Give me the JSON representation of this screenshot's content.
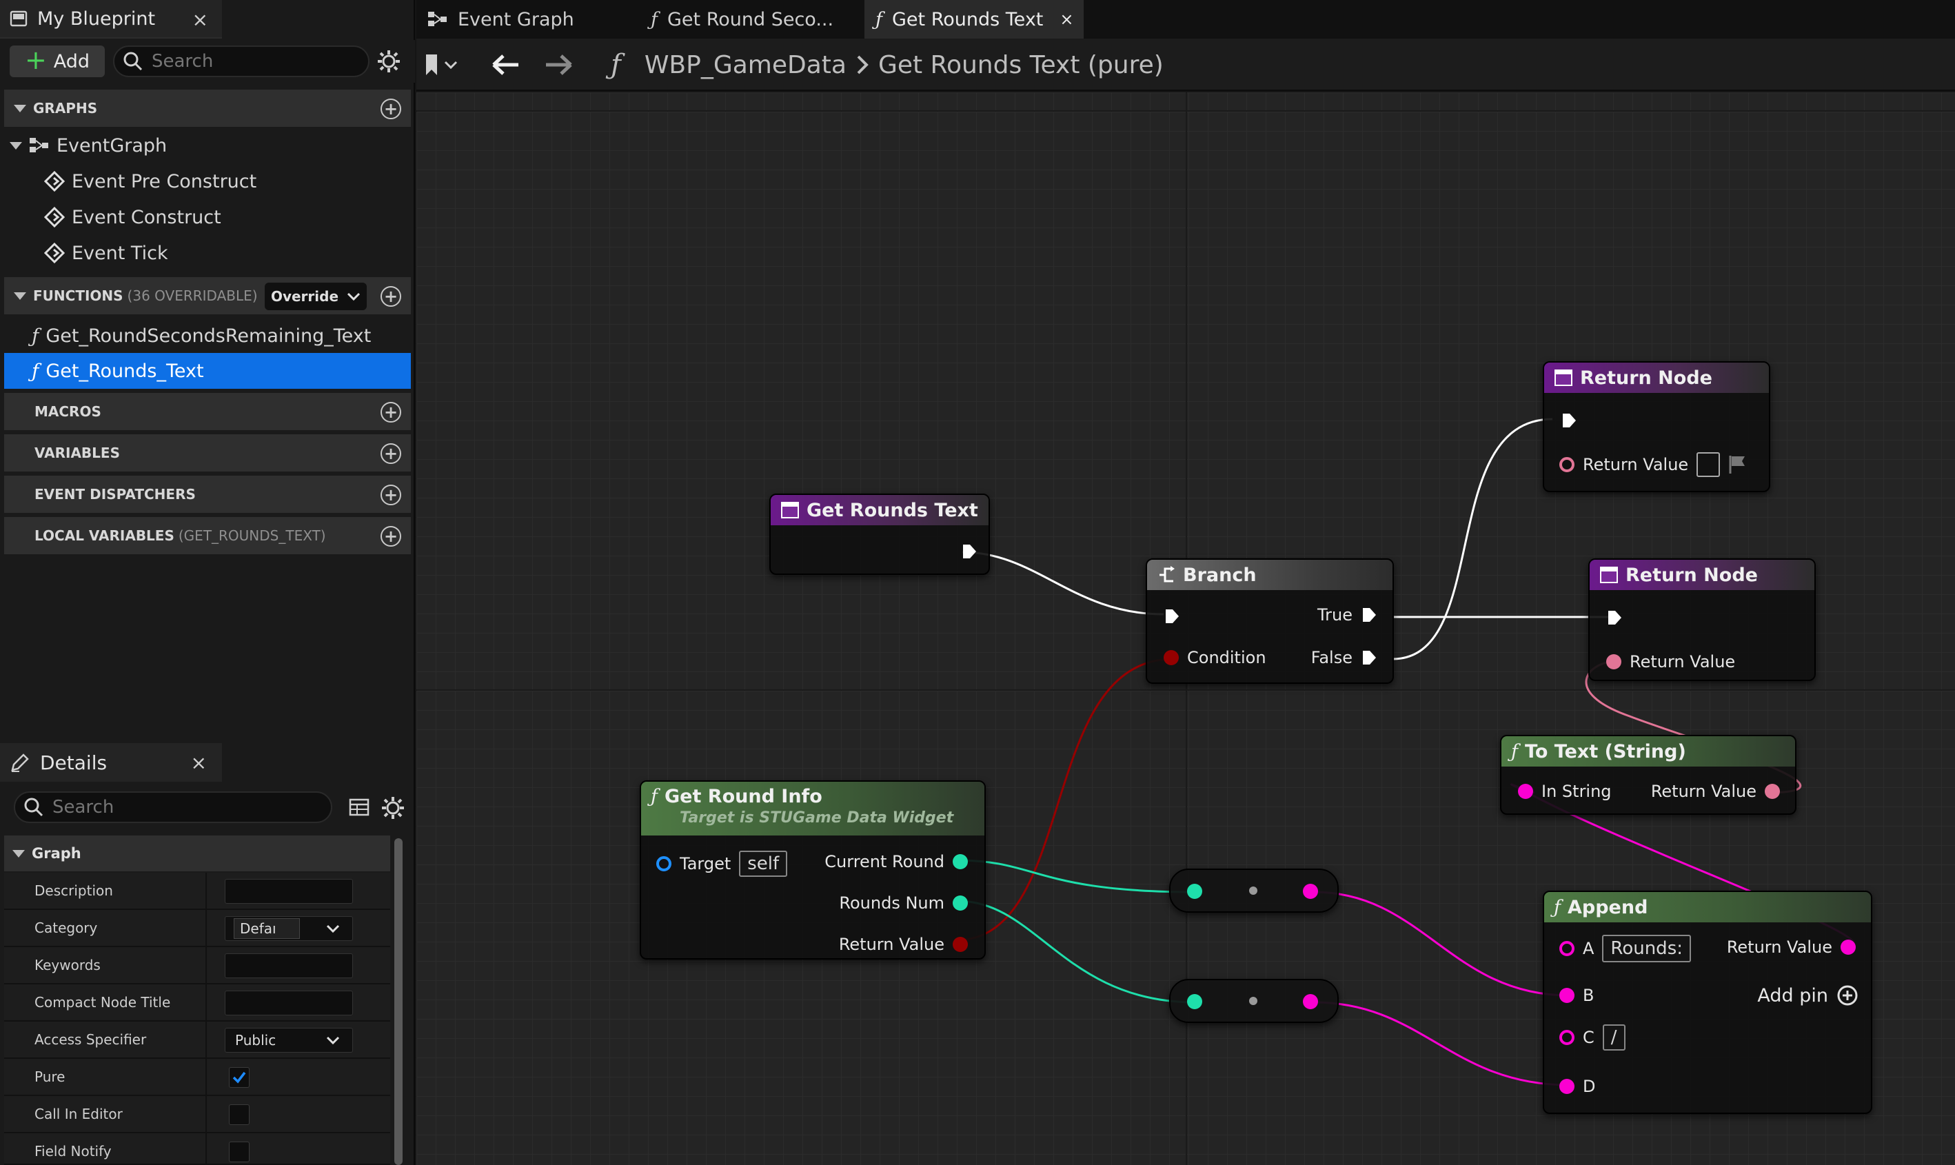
{
  "my_blueprint": {
    "tab_label": "My Blueprint",
    "add_label": "Add",
    "search_placeholder": "Search",
    "graphs": {
      "header": "GRAPHS",
      "event_graph": "EventGraph",
      "events": [
        "Event Pre Construct",
        "Event Construct",
        "Event Tick"
      ]
    },
    "functions": {
      "header": "FUNCTIONS",
      "count_label": "(36 OVERRIDABLE)",
      "override_label": "Override",
      "items": [
        "Get_RoundSecondsRemaining_Text",
        "Get_Rounds_Text"
      ]
    },
    "macros_header": "MACROS",
    "variables_header": "VARIABLES",
    "dispatchers_header": "EVENT DISPATCHERS",
    "local_vars": {
      "header": "LOCAL VARIABLES",
      "sub": "(GET_ROUNDS_TEXT)"
    }
  },
  "details": {
    "tab_label": "Details",
    "search_placeholder": "Search",
    "section": "Graph",
    "rows": {
      "description": "Description",
      "category": "Category",
      "category_value": "Defaı",
      "keywords": "Keywords",
      "compact_title": "Compact Node Title",
      "access": "Access Specifier",
      "access_value": "Public",
      "pure": "Pure",
      "call_in_editor": "Call In Editor",
      "field_notify": "Field Notify"
    },
    "pure_checked": true
  },
  "tabs": {
    "event_graph": "Event Graph",
    "get_round_seconds": "Get Round Seco...",
    "get_rounds_text": "Get Rounds Text"
  },
  "breadcrumb": {
    "blueprint": "WBP_GameData",
    "function": "Get Rounds Text (pure)"
  },
  "nodes": {
    "entry": {
      "title": "Get Rounds Text"
    },
    "branch": {
      "title": "Branch",
      "true": "True",
      "false": "False",
      "condition": "Condition"
    },
    "return1": {
      "title": "Return Node",
      "return_value": "Return Value"
    },
    "return2": {
      "title": "Return Node",
      "return_value": "Return Value"
    },
    "totext": {
      "title": "To Text (String)",
      "in_string": "In String",
      "return_value": "Return Value"
    },
    "roundinfo": {
      "title": "Get Round Info",
      "subtitle": "Target is STUGame Data Widget",
      "target": "Target",
      "target_value": "self",
      "current_round": "Current Round",
      "rounds_num": "Rounds Num",
      "return_value": "Return Value"
    },
    "append": {
      "title": "Append",
      "a": "A",
      "a_value": "Rounds:",
      "b": "B",
      "c": "C",
      "c_value": "/",
      "d": "D",
      "return_value": "Return Value",
      "add_pin": "Add pin"
    }
  },
  "colors": {
    "exec": "#ffffff",
    "bool": "#950000",
    "int": "#1edfab",
    "string": "#fb00d1",
    "text": "#e27596",
    "selection": "#0e70e6",
    "add_green": "#4bd35a"
  }
}
